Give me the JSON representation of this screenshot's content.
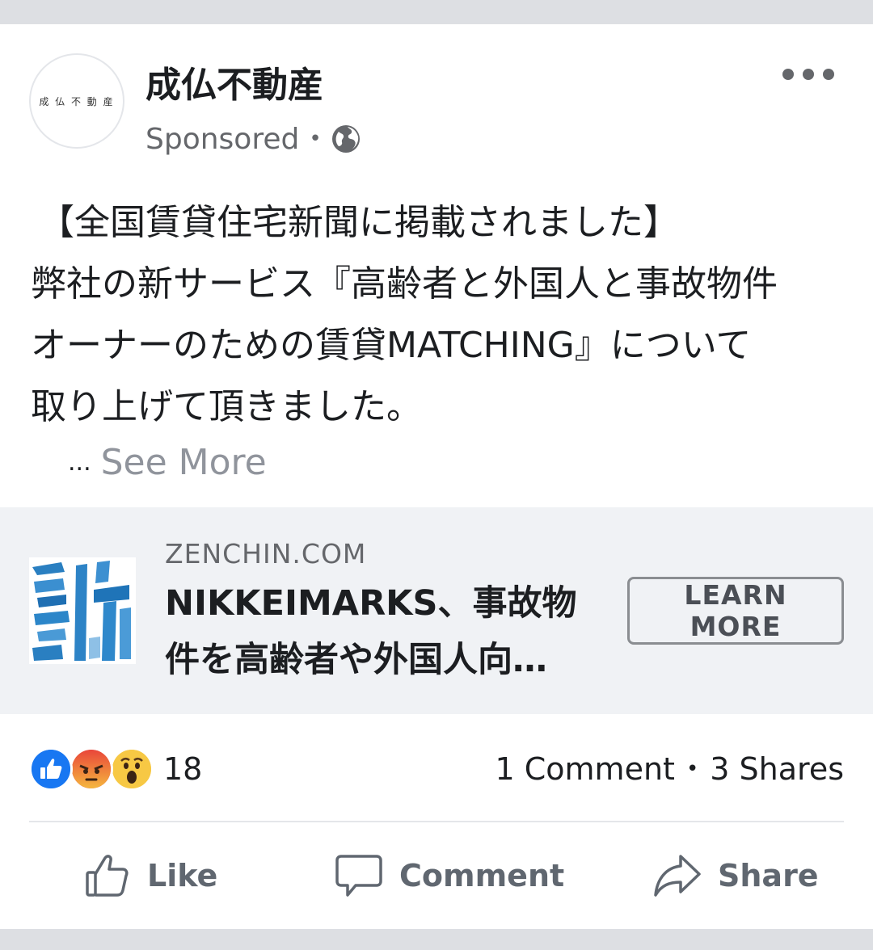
{
  "post": {
    "page_name": "成仏不動産",
    "avatar_text": "成 仏 不 動 産",
    "sponsored_label": "Sponsored",
    "meta_separator": "•",
    "privacy_icon": "globe-icon",
    "more_icon": "more-dots-icon",
    "text_lines": [
      "【全国賃貸住宅新聞に掲載されました】",
      "弊社の新サービス『高齢者と外国人と事故物件",
      "オーナーのための賃貸MATCHING』について",
      "取り上げて頂きました。"
    ],
    "ellipsis": "...",
    "see_more": "See More"
  },
  "link": {
    "domain": "ZENCHIN.COM",
    "title_lines": [
      "NIKKEIMARKS、事故物",
      "件を高齢者や外国人向…"
    ],
    "cta": "LEARN MORE"
  },
  "engagement": {
    "reaction_icons": [
      "like-reaction-icon",
      "angry-reaction-icon",
      "wow-reaction-icon"
    ],
    "reaction_count": "18",
    "comments": "1 Comment",
    "separator": "•",
    "shares": "3 Shares"
  },
  "actions": {
    "like": "Like",
    "comment": "Comment",
    "share": "Share"
  },
  "colors": {
    "facebook_blue": "#1877f2",
    "secondary_text": "#65676b",
    "link_box_bg": "#f0f2f5"
  }
}
